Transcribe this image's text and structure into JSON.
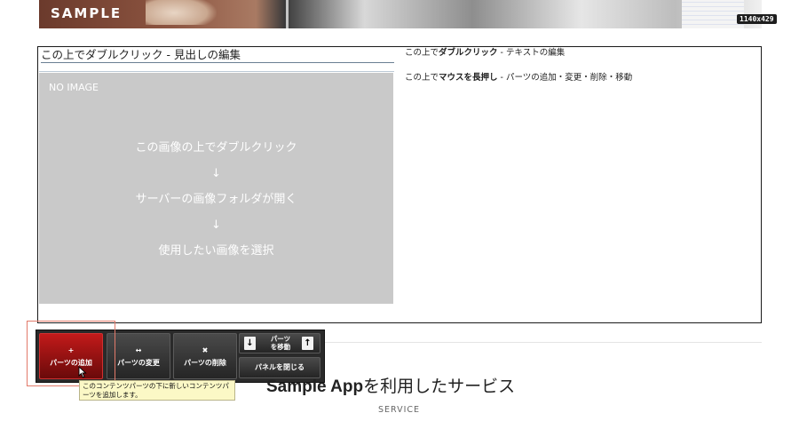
{
  "banner": {
    "sample_text": "SAMPLE",
    "size_badge": "1140x429"
  },
  "block": {
    "heading": "この上でダブルクリック - 見出しの編集",
    "no_image": {
      "tag": "NO IMAGE",
      "lines": [
        "この画像の上でダブルクリック",
        "↓",
        "サーバーの画像フォルダが開く",
        "↓",
        "使用したい画像を選択"
      ]
    },
    "text_rows": [
      {
        "pre": "この上で",
        "bold": "ダブルクリック",
        "post": " - テキストの編集"
      },
      {
        "pre": "この上で",
        "bold": "マウスを長押し",
        "post": " - パーツの追加・変更・削除・移動"
      }
    ]
  },
  "toolbar": {
    "add": {
      "icon": "+",
      "label": "パーツの追加"
    },
    "change": {
      "icon": "↔",
      "label": "パーツの変更"
    },
    "delete": {
      "icon": "✖",
      "label": "パーツの削除"
    },
    "move": {
      "up": "↑",
      "down": "↓",
      "label_1": "パーツ",
      "label_2": "を移動"
    },
    "close_label": "パネルを閉じる"
  },
  "tooltip": "このコンテンツパーツの下に新しいコンテンツパーツを追加します。",
  "service": {
    "title_bold": "Sample App",
    "title_rest": "を利用したサービス",
    "subtitle": "SERVICE"
  },
  "colors": {
    "accent_red": "#c21a1a",
    "highlight": "#e27a6a",
    "tooltip_bg": "#fbf8c6"
  }
}
